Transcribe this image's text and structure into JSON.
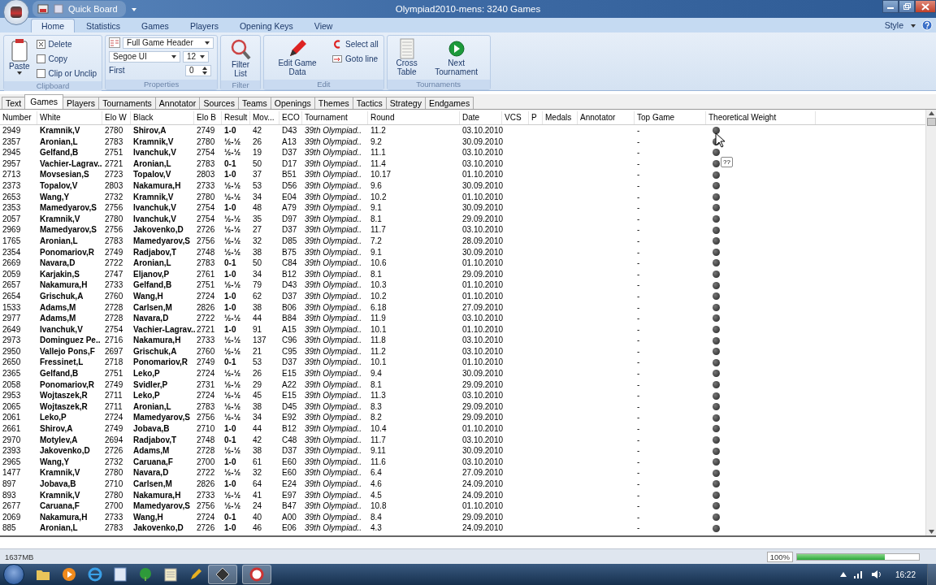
{
  "window": {
    "title": "Olympiad2010-mens:  3240 Games",
    "quick_access": "Quick Board"
  },
  "ribbon_tabs": [
    {
      "label": "Home",
      "selected": true
    },
    {
      "label": "Statistics",
      "selected": false
    },
    {
      "label": "Games",
      "selected": false
    },
    {
      "label": "Players",
      "selected": false
    },
    {
      "label": "Opening Keys",
      "selected": false
    },
    {
      "label": "View",
      "selected": false
    }
  ],
  "style_menu": "Style",
  "ribbon": {
    "clipboard": {
      "label": "Clipboard",
      "paste": "Paste",
      "items": [
        "Delete",
        "Copy",
        "Clip or Unclip"
      ]
    },
    "properties": {
      "label": "Properties",
      "header_format": "Full Game Header",
      "font": "Segoe UI",
      "size": "12",
      "first_label": "First",
      "first_value": "0"
    },
    "filter": {
      "label": "Filter",
      "button": "Filter List"
    },
    "edit": {
      "label": "Edit",
      "button": "Edit Game Data",
      "items": [
        "Select all",
        "Goto line"
      ]
    },
    "tournaments": {
      "label": "Tournaments",
      "buttons": [
        "Cross Table",
        "Next Tournament"
      ]
    }
  },
  "doc_tabs": [
    {
      "label": "Text",
      "selected": false
    },
    {
      "label": "Games",
      "selected": true
    },
    {
      "label": "Players",
      "selected": false
    },
    {
      "label": "Tournaments",
      "selected": false
    },
    {
      "label": "Annotator",
      "selected": false
    },
    {
      "label": "Sources",
      "selected": false
    },
    {
      "label": "Teams",
      "selected": false
    },
    {
      "label": "Openings",
      "selected": false
    },
    {
      "label": "Themes",
      "selected": false
    },
    {
      "label": "Tactics",
      "selected": false
    },
    {
      "label": "Strategy",
      "selected": false
    },
    {
      "label": "Endgames",
      "selected": false
    }
  ],
  "table": {
    "columns": [
      "Number",
      "White",
      "Elo W",
      "Black",
      "Elo B",
      "Result",
      "Mov...",
      "ECO",
      "Tournament",
      "Round",
      "Date",
      "VCS",
      "P",
      "Medals",
      "Annotator",
      "Top Game",
      "Theoretical Weight"
    ],
    "rows": [
      {
        "number": "2949",
        "white": "Kramnik,V",
        "elo_w": "2780",
        "black": "Shirov,A",
        "elo_b": "2749",
        "result": "1-0",
        "moves": "42",
        "eco": "D43",
        "tournament": "39th Olympiad..",
        "round": "11.2",
        "date": "03.10.2010",
        "top_game": "-"
      },
      {
        "number": "2357",
        "white": "Aronian,L",
        "elo_w": "2783",
        "black": "Kramnik,V",
        "elo_b": "2780",
        "result": "½-½",
        "moves": "26",
        "eco": "A13",
        "tournament": "39th Olympiad..",
        "round": "9.2",
        "date": "30.09.2010",
        "top_game": "-"
      },
      {
        "number": "2945",
        "white": "Gelfand,B",
        "elo_w": "2751",
        "black": "Ivanchuk,V",
        "elo_b": "2754",
        "result": "½-½",
        "moves": "19",
        "eco": "D37",
        "tournament": "39th Olympiad..",
        "round": "11.1",
        "date": "03.10.2010",
        "top_game": "-"
      },
      {
        "number": "2957",
        "white": "Vachier-Lagrav..",
        "elo_w": "2721",
        "black": "Aronian,L",
        "elo_b": "2783",
        "result": "0-1",
        "moves": "50",
        "eco": "D17",
        "tournament": "39th Olympiad..",
        "round": "11.4",
        "date": "03.10.2010",
        "top_game": "-"
      },
      {
        "number": "2713",
        "white": "Movsesian,S",
        "elo_w": "2723",
        "black": "Topalov,V",
        "elo_b": "2803",
        "result": "1-0",
        "moves": "37",
        "eco": "B51",
        "tournament": "39th Olympiad..",
        "round": "10.17",
        "date": "01.10.2010",
        "top_game": "-"
      },
      {
        "number": "2373",
        "white": "Topalov,V",
        "elo_w": "2803",
        "black": "Nakamura,H",
        "elo_b": "2733",
        "result": "½-½",
        "moves": "53",
        "eco": "D56",
        "tournament": "39th Olympiad..",
        "round": "9.6",
        "date": "30.09.2010",
        "top_game": "-"
      },
      {
        "number": "2653",
        "white": "Wang,Y",
        "elo_w": "2732",
        "black": "Kramnik,V",
        "elo_b": "2780",
        "result": "½-½",
        "moves": "34",
        "eco": "E04",
        "tournament": "39th Olympiad..",
        "round": "10.2",
        "date": "01.10.2010",
        "top_game": "-"
      },
      {
        "number": "2353",
        "white": "Mamedyarov,S",
        "elo_w": "2756",
        "black": "Ivanchuk,V",
        "elo_b": "2754",
        "result": "1-0",
        "moves": "48",
        "eco": "A79",
        "tournament": "39th Olympiad..",
        "round": "9.1",
        "date": "30.09.2010",
        "top_game": "-"
      },
      {
        "number": "2057",
        "white": "Kramnik,V",
        "elo_w": "2780",
        "black": "Ivanchuk,V",
        "elo_b": "2754",
        "result": "½-½",
        "moves": "35",
        "eco": "D97",
        "tournament": "39th Olympiad..",
        "round": "8.1",
        "date": "29.09.2010",
        "top_game": "-"
      },
      {
        "number": "2969",
        "white": "Mamedyarov,S",
        "elo_w": "2756",
        "black": "Jakovenko,D",
        "elo_b": "2726",
        "result": "½-½",
        "moves": "27",
        "eco": "D37",
        "tournament": "39th Olympiad..",
        "round": "11.7",
        "date": "03.10.2010",
        "top_game": "-"
      },
      {
        "number": "1765",
        "white": "Aronian,L",
        "elo_w": "2783",
        "black": "Mamedyarov,S",
        "elo_b": "2756",
        "result": "½-½",
        "moves": "32",
        "eco": "D85",
        "tournament": "39th Olympiad..",
        "round": "7.2",
        "date": "28.09.2010",
        "top_game": "-"
      },
      {
        "number": "2354",
        "white": "Ponomariov,R",
        "elo_w": "2749",
        "black": "Radjabov,T",
        "elo_b": "2748",
        "result": "½-½",
        "moves": "38",
        "eco": "B75",
        "tournament": "39th Olympiad..",
        "round": "9.1",
        "date": "30.09.2010",
        "top_game": "-"
      },
      {
        "number": "2669",
        "white": "Navara,D",
        "elo_w": "2722",
        "black": "Aronian,L",
        "elo_b": "2783",
        "result": "0-1",
        "moves": "50",
        "eco": "C84",
        "tournament": "39th Olympiad..",
        "round": "10.6",
        "date": "01.10.2010",
        "top_game": "-"
      },
      {
        "number": "2059",
        "white": "Karjakin,S",
        "elo_w": "2747",
        "black": "Eljanov,P",
        "elo_b": "2761",
        "result": "1-0",
        "moves": "34",
        "eco": "B12",
        "tournament": "39th Olympiad..",
        "round": "8.1",
        "date": "29.09.2010",
        "top_game": "-"
      },
      {
        "number": "2657",
        "white": "Nakamura,H",
        "elo_w": "2733",
        "black": "Gelfand,B",
        "elo_b": "2751",
        "result": "½-½",
        "moves": "79",
        "eco": "D43",
        "tournament": "39th Olympiad..",
        "round": "10.3",
        "date": "01.10.2010",
        "top_game": "-"
      },
      {
        "number": "2654",
        "white": "Grischuk,A",
        "elo_w": "2760",
        "black": "Wang,H",
        "elo_b": "2724",
        "result": "1-0",
        "moves": "62",
        "eco": "D37",
        "tournament": "39th Olympiad..",
        "round": "10.2",
        "date": "01.10.2010",
        "top_game": "-"
      },
      {
        "number": "1533",
        "white": "Adams,M",
        "elo_w": "2728",
        "black": "Carlsen,M",
        "elo_b": "2826",
        "result": "1-0",
        "moves": "38",
        "eco": "B06",
        "tournament": "39th Olympiad..",
        "round": "6.18",
        "date": "27.09.2010",
        "top_game": "-"
      },
      {
        "number": "2977",
        "white": "Adams,M",
        "elo_w": "2728",
        "black": "Navara,D",
        "elo_b": "2722",
        "result": "½-½",
        "moves": "44",
        "eco": "B84",
        "tournament": "39th Olympiad..",
        "round": "11.9",
        "date": "03.10.2010",
        "top_game": "-"
      },
      {
        "number": "2649",
        "white": "Ivanchuk,V",
        "elo_w": "2754",
        "black": "Vachier-Lagrav..",
        "elo_b": "2721",
        "result": "1-0",
        "moves": "91",
        "eco": "A15",
        "tournament": "39th Olympiad..",
        "round": "10.1",
        "date": "01.10.2010",
        "top_game": "-"
      },
      {
        "number": "2973",
        "white": "Dominguez Pe..",
        "elo_w": "2716",
        "black": "Nakamura,H",
        "elo_b": "2733",
        "result": "½-½",
        "moves": "137",
        "eco": "C96",
        "tournament": "39th Olympiad..",
        "round": "11.8",
        "date": "03.10.2010",
        "top_game": "-"
      },
      {
        "number": "2950",
        "white": "Vallejo Pons,F",
        "elo_w": "2697",
        "black": "Grischuk,A",
        "elo_b": "2760",
        "result": "½-½",
        "moves": "21",
        "eco": "C95",
        "tournament": "39th Olympiad..",
        "round": "11.2",
        "date": "03.10.2010",
        "top_game": "-"
      },
      {
        "number": "2650",
        "white": "Fressinet,L",
        "elo_w": "2718",
        "black": "Ponomariov,R",
        "elo_b": "2749",
        "result": "0-1",
        "moves": "53",
        "eco": "D37",
        "tournament": "39th Olympiad..",
        "round": "10.1",
        "date": "01.10.2010",
        "top_game": "-"
      },
      {
        "number": "2365",
        "white": "Gelfand,B",
        "elo_w": "2751",
        "black": "Leko,P",
        "elo_b": "2724",
        "result": "½-½",
        "moves": "26",
        "eco": "E15",
        "tournament": "39th Olympiad..",
        "round": "9.4",
        "date": "30.09.2010",
        "top_game": "-"
      },
      {
        "number": "2058",
        "white": "Ponomariov,R",
        "elo_w": "2749",
        "black": "Svidler,P",
        "elo_b": "2731",
        "result": "½-½",
        "moves": "29",
        "eco": "A22",
        "tournament": "39th Olympiad..",
        "round": "8.1",
        "date": "29.09.2010",
        "top_game": "-"
      },
      {
        "number": "2953",
        "white": "Wojtaszek,R",
        "elo_w": "2711",
        "black": "Leko,P",
        "elo_b": "2724",
        "result": "½-½",
        "moves": "45",
        "eco": "E15",
        "tournament": "39th Olympiad..",
        "round": "11.3",
        "date": "03.10.2010",
        "top_game": "-"
      },
      {
        "number": "2065",
        "white": "Wojtaszek,R",
        "elo_w": "2711",
        "black": "Aronian,L",
        "elo_b": "2783",
        "result": "½-½",
        "moves": "38",
        "eco": "D45",
        "tournament": "39th Olympiad..",
        "round": "8.3",
        "date": "29.09.2010",
        "top_game": "-"
      },
      {
        "number": "2061",
        "white": "Leko,P",
        "elo_w": "2724",
        "black": "Mamedyarov,S",
        "elo_b": "2756",
        "result": "½-½",
        "moves": "34",
        "eco": "E92",
        "tournament": "39th Olympiad..",
        "round": "8.2",
        "date": "29.09.2010",
        "top_game": "-"
      },
      {
        "number": "2661",
        "white": "Shirov,A",
        "elo_w": "2749",
        "black": "Jobava,B",
        "elo_b": "2710",
        "result": "1-0",
        "moves": "44",
        "eco": "B12",
        "tournament": "39th Olympiad..",
        "round": "10.4",
        "date": "01.10.2010",
        "top_game": "-"
      },
      {
        "number": "2970",
        "white": "Motylev,A",
        "elo_w": "2694",
        "black": "Radjabov,T",
        "elo_b": "2748",
        "result": "0-1",
        "moves": "42",
        "eco": "C48",
        "tournament": "39th Olympiad..",
        "round": "11.7",
        "date": "03.10.2010",
        "top_game": "-"
      },
      {
        "number": "2393",
        "white": "Jakovenko,D",
        "elo_w": "2726",
        "black": "Adams,M",
        "elo_b": "2728",
        "result": "½-½",
        "moves": "38",
        "eco": "D37",
        "tournament": "39th Olympiad..",
        "round": "9.11",
        "date": "30.09.2010",
        "top_game": "-"
      },
      {
        "number": "2965",
        "white": "Wang,Y",
        "elo_w": "2732",
        "black": "Caruana,F",
        "elo_b": "2700",
        "result": "1-0",
        "moves": "61",
        "eco": "E60",
        "tournament": "39th Olympiad..",
        "round": "11.6",
        "date": "03.10.2010",
        "top_game": "-"
      },
      {
        "number": "1477",
        "white": "Kramnik,V",
        "elo_w": "2780",
        "black": "Navara,D",
        "elo_b": "2722",
        "result": "½-½",
        "moves": "32",
        "eco": "E60",
        "tournament": "39th Olympiad..",
        "round": "6.4",
        "date": "27.09.2010",
        "top_game": "-"
      },
      {
        "number": "897",
        "white": "Jobava,B",
        "elo_w": "2710",
        "black": "Carlsen,M",
        "elo_b": "2826",
        "result": "1-0",
        "moves": "64",
        "eco": "E24",
        "tournament": "39th Olympiad..",
        "round": "4.6",
        "date": "24.09.2010",
        "top_game": "-"
      },
      {
        "number": "893",
        "white": "Kramnik,V",
        "elo_w": "2780",
        "black": "Nakamura,H",
        "elo_b": "2733",
        "result": "½-½",
        "moves": "41",
        "eco": "E97",
        "tournament": "39th Olympiad..",
        "round": "4.5",
        "date": "24.09.2010",
        "top_game": "-"
      },
      {
        "number": "2677",
        "white": "Caruana,F",
        "elo_w": "2700",
        "black": "Mamedyarov,S",
        "elo_b": "2756",
        "result": "½-½",
        "moves": "24",
        "eco": "B47",
        "tournament": "39th Olympiad..",
        "round": "10.8",
        "date": "01.10.2010",
        "top_game": "-"
      },
      {
        "number": "2069",
        "white": "Nakamura,H",
        "elo_w": "2733",
        "black": "Wang,H",
        "elo_b": "2724",
        "result": "0-1",
        "moves": "40",
        "eco": "A00",
        "tournament": "39th Olympiad..",
        "round": "8.4",
        "date": "29.09.2010",
        "top_game": "-"
      },
      {
        "number": "885",
        "white": "Aronian,L",
        "elo_w": "2783",
        "black": "Jakovenko,D",
        "elo_b": "2726",
        "result": "1-0",
        "moves": "46",
        "eco": "E06",
        "tournament": "39th Olympiad..",
        "round": "4.3",
        "date": "24.09.2010",
        "top_game": "-"
      }
    ]
  },
  "tooltip": "??",
  "status_bar": {
    "memory": "1637MB",
    "zoom": "100%",
    "level": 0.72
  },
  "taskbar": {
    "time": "16:22"
  }
}
